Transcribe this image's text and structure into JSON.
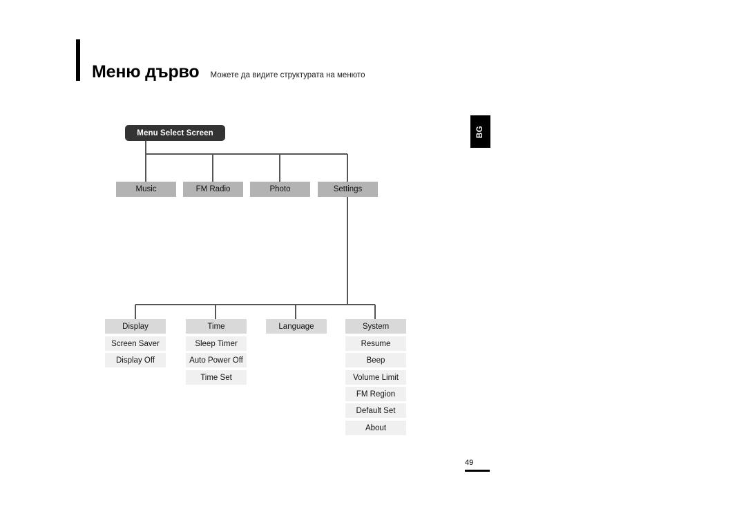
{
  "header": {
    "title": "Меню дърво",
    "subtitle": "Можете да видите структурата на менюто"
  },
  "language_tab": {
    "label": "BG"
  },
  "footer": {
    "page_number": "49"
  },
  "tree": {
    "root": {
      "label": "Menu Select Screen"
    },
    "level1": [
      {
        "label": "Music"
      },
      {
        "label": "FM Radio"
      },
      {
        "label": "Photo"
      },
      {
        "label": "Settings"
      }
    ],
    "settings_groups": [
      {
        "header": "Display",
        "items": [
          "Screen Saver",
          "Display Off"
        ]
      },
      {
        "header": "Time",
        "items": [
          "Sleep Timer",
          "Auto Power Off",
          "Time Set"
        ]
      },
      {
        "header": "Language",
        "items": []
      },
      {
        "header": "System",
        "items": [
          "Resume",
          "Beep",
          "Volume Limit",
          "FM Region",
          "Default Set",
          "About"
        ]
      }
    ]
  },
  "colors": {
    "root_box": "#333333",
    "level1_box": "#b3b3b3",
    "group_header_box": "#d9d9d9",
    "item_box": "#f0f0f0",
    "connector_line": "#555555",
    "accent_rule": "#000000"
  }
}
